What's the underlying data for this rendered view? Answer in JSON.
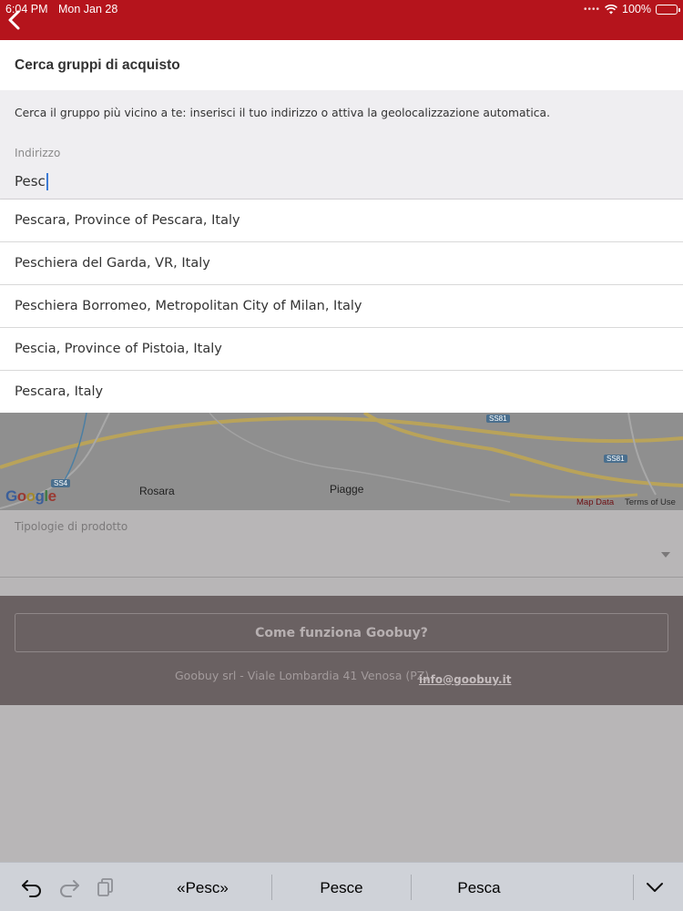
{
  "status_bar": {
    "time": "6:04 PM",
    "date": "Mon Jan 28",
    "battery": "100%"
  },
  "app_bar": {
    "back_icon": "chevron-left-icon",
    "color": "#b5141c"
  },
  "page": {
    "title": "Cerca gruppi di acquisto"
  },
  "search": {
    "description": "Cerca il gruppo più vicino a te: inserisci il tuo indirizzo o attiva la geolocalizzazione automatica.",
    "address_label": "Indirizzo",
    "address_value": "Pesc"
  },
  "suggestions": [
    "Pescara, Province of Pescara, Italy",
    "Peschiera del Garda, VR, Italy",
    "Peschiera Borromeo, Metropolitan City of Milan, Italy",
    "Pescia, Province of Pistoia, Italy",
    "Pescara, Italy"
  ],
  "map": {
    "places": [
      "Rosara",
      "Piagge"
    ],
    "roads": [
      "SS4",
      "SS81",
      "SS81"
    ],
    "logo": "Google",
    "map_data": "Map Data",
    "terms": "Terms of Use"
  },
  "product": {
    "label": "Tipologie di prodotto"
  },
  "footer": {
    "how_button": "Come funziona Goobuy?",
    "company": "Goobuy srl - Viale Lombardia 41 Venosa (PZ)",
    "email": "info@goobuy.it"
  },
  "keyboard_bar": {
    "undo_icon": "undo-icon",
    "redo_icon": "redo-icon",
    "paste_icon": "paste-icon",
    "suggestions": [
      "«Pesc»",
      "Pesce",
      "Pesca"
    ],
    "dismiss_icon": "keyboard-dismiss-icon"
  }
}
